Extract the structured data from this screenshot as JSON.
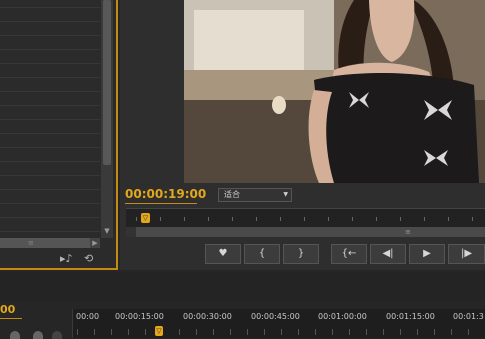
{
  "project_panel": {
    "scroll_grip": "≡",
    "scroll_down": "▼",
    "scroll_right": "▶",
    "icons": [
      "automate-to-sequence-icon",
      "refresh-icon"
    ]
  },
  "program_monitor": {
    "timecode": "00:00:19:00",
    "fit": "适合",
    "scroll_grip": "≡",
    "playhead_glyph": "▽",
    "buttons": [
      {
        "name": "marker-button",
        "glyph": "♥"
      },
      {
        "name": "mark-in-button",
        "glyph": "{"
      },
      {
        "name": "mark-out-button",
        "glyph": "}"
      },
      {
        "name": "go-to-in-button",
        "glyph": "{←"
      },
      {
        "name": "step-back-button",
        "glyph": "◀|"
      },
      {
        "name": "play-button",
        "glyph": "▶"
      },
      {
        "name": "step-forward-button",
        "glyph": "|▶"
      }
    ]
  },
  "timeline": {
    "timecode": "00",
    "playhead_glyph": "▽",
    "ruler_labels": [
      "00:00",
      "00:00:15:00",
      "00:00:30:00",
      "00:00:45:00",
      "00:01:00:00",
      "00:01:15:00",
      "00:01:3"
    ]
  },
  "colors": {
    "accent": "#e3a81c",
    "panel_border": "#c48a12",
    "background": "#262626"
  }
}
